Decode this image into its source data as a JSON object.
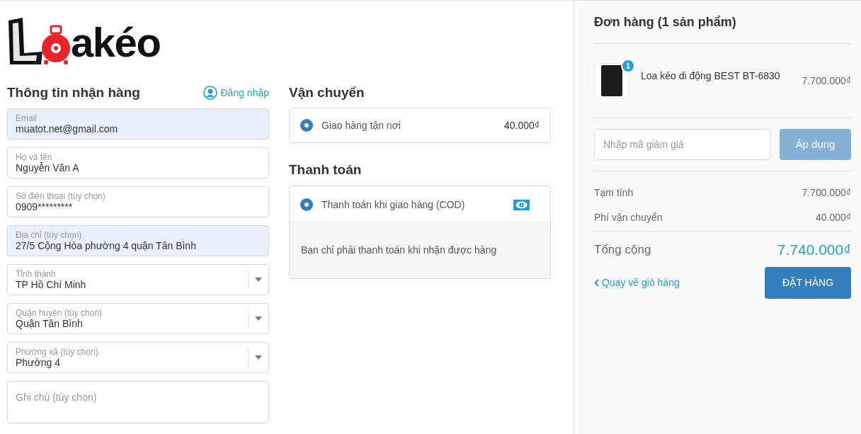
{
  "logo": {
    "text": "akéo"
  },
  "customer_info": {
    "title": "Thông tin nhận hàng",
    "login_link": "Đăng nhập",
    "fields": [
      {
        "kind": "input",
        "label": "Email",
        "value": "muatot.net@gmail.com",
        "autofilled": true
      },
      {
        "kind": "input",
        "label": "Họ và tên",
        "value": "Nguyễn Văn A",
        "autofilled": false
      },
      {
        "kind": "input",
        "label": "Số điện thoại (tùy chọn)",
        "value": "0909*********",
        "autofilled": false
      },
      {
        "kind": "input",
        "label": "Địa chỉ (tùy chọn)",
        "value": "27/5 Cộng Hòa phường 4 quận Tân Bình",
        "autofilled": true
      },
      {
        "kind": "select",
        "label": "Tỉnh thành",
        "value": "TP Hồ Chí Minh",
        "autofilled": false
      },
      {
        "kind": "select",
        "label": "Quận huyện (tùy chọn)",
        "value": "Quận Tân Bình",
        "autofilled": false
      },
      {
        "kind": "select",
        "label": "Phường xã (tùy chọn)",
        "value": "Phường 4",
        "autofilled": false
      },
      {
        "kind": "textarea",
        "placeholder": "Ghi chú (tùy chọn)",
        "autofilled": false
      }
    ]
  },
  "shipping": {
    "title": "Vận chuyển",
    "options": [
      {
        "label": "Giao hàng tận nơi",
        "price": "40.000₫",
        "selected": true
      }
    ]
  },
  "payment": {
    "title": "Thanh toán",
    "options": [
      {
        "label": "Thanh toán khi giao hàng (COD)",
        "selected": true,
        "note": "Bạn chỉ phải thanh toán khi nhận được hàng"
      }
    ]
  },
  "order": {
    "title": "Đơn hàng (1 sản phẩm)",
    "items": [
      {
        "quantity": "1",
        "name": "Loa kéo di động BEST BT-6830",
        "price": "7.700.000₫"
      }
    ],
    "discount": {
      "placeholder": "Nhập mã giảm giá",
      "button": "Áp dụng",
      "disabled": true
    },
    "summary": [
      {
        "label": "Tạm tính",
        "value": "7.700.000₫"
      },
      {
        "label": "Phí vận chuyển",
        "value": "40.000₫"
      }
    ],
    "total": {
      "label": "Tổng cộng",
      "value": "7.740.000₫"
    },
    "back_link": "Quay về giỏ hàng",
    "submit": "ĐẶT HÀNG"
  }
}
